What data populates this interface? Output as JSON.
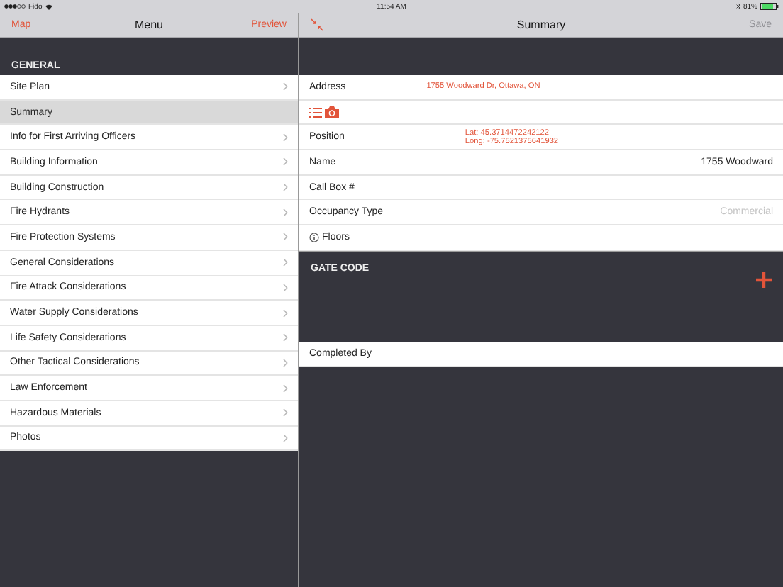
{
  "status_bar": {
    "carrier": "Fido",
    "time": "11:54 AM",
    "battery": "81%"
  },
  "menu_nav": {
    "left": "Map",
    "title": "Menu",
    "right": "Preview"
  },
  "menu": {
    "section": "GENERAL",
    "items": [
      {
        "label": "Site Plan",
        "selected": false
      },
      {
        "label": "Summary",
        "selected": true
      },
      {
        "label": "Info for First Arriving Officers",
        "selected": false
      },
      {
        "label": "Building Information",
        "selected": false
      },
      {
        "label": "Building Construction",
        "selected": false
      },
      {
        "label": "Fire Hydrants",
        "selected": false
      },
      {
        "label": "Fire Protection Systems",
        "selected": false
      },
      {
        "label": "General Considerations",
        "selected": false
      },
      {
        "label": "Fire Attack Considerations",
        "selected": false
      },
      {
        "label": "Water Supply Considerations",
        "selected": false
      },
      {
        "label": "Life Safety Considerations",
        "selected": false
      },
      {
        "label": "Other Tactical Considerations",
        "selected": false
      },
      {
        "label": "Law Enforcement",
        "selected": false
      },
      {
        "label": "Hazardous Materials",
        "selected": false
      },
      {
        "label": "Photos",
        "selected": false
      }
    ]
  },
  "detail_nav": {
    "title": "Summary",
    "save": {
      "label": "Save",
      "disabled": true
    }
  },
  "fields": [
    {
      "kind": "link",
      "label": "Address",
      "value": "1755 Woodward Dr, Ottawa, ON"
    },
    {
      "kind": "icons"
    },
    {
      "kind": "lines",
      "label": "Position",
      "lines": [
        "Lat: 45.3714472242122",
        "Long: -75.7521375641932"
      ]
    },
    {
      "kind": "text",
      "label": "Name",
      "value": "1755 Woodward"
    },
    {
      "kind": "text",
      "label": "Call Box #"
    },
    {
      "kind": "text",
      "label": "Occupancy Type",
      "placeholder": "Commercial"
    },
    {
      "kind": "info",
      "label": "Floors"
    }
  ],
  "gate_code": {
    "title": "GATE CODE"
  },
  "completed_by": {
    "label": "Completed By"
  }
}
